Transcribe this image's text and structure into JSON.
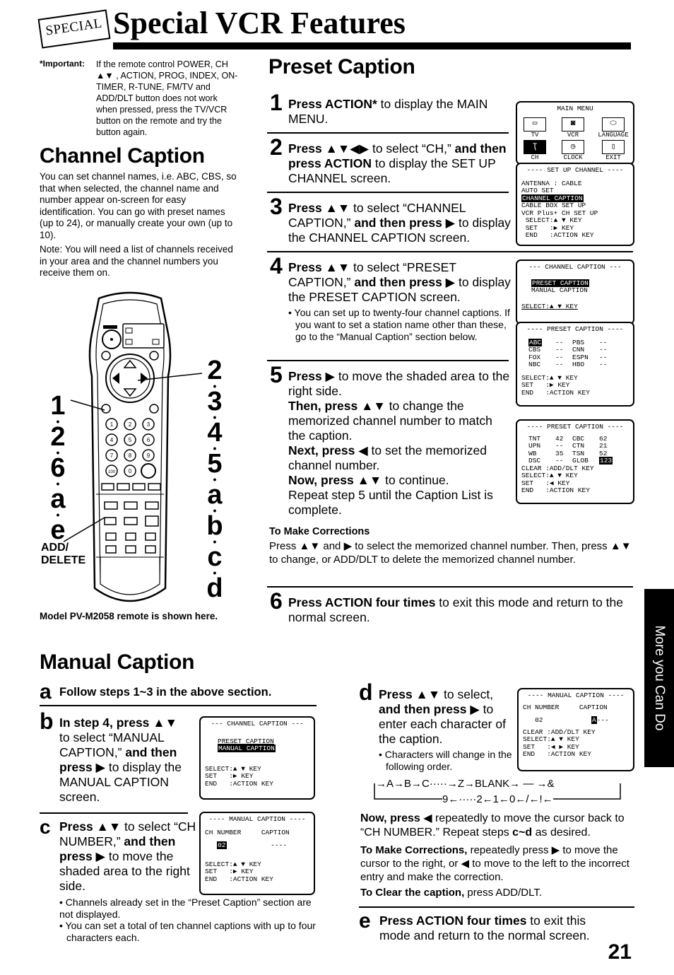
{
  "header": {
    "badge": "SPECIAL",
    "title": "Special VCR Features"
  },
  "important": {
    "label": "*Important:",
    "text": "If the remote control POWER, CH ▲▼ , ACTION, PROG, INDEX, ON-TIMER, R-TUNE, FM/TV and ADD/DLT button does not work when pressed, press the TV/VCR button on the remote and try the button again."
  },
  "channel_caption": {
    "heading": "Channel Caption",
    "intro": "You can set channel names, i.e. ABC, CBS, so that when selected, the channel name and number appear on-screen for easy identification. You can go with preset names (up to 24), or manually create your own (up to 10).",
    "note": "Note: You will need a list of channels received in your area and the channel numbers you receive them on."
  },
  "remote": {
    "left_callouts": [
      "1",
      "2",
      "6",
      "a",
      "e"
    ],
    "right_callouts": [
      "2",
      "3",
      "4",
      "5",
      "a",
      "b",
      "c",
      "d"
    ],
    "add_delete_label_1": "ADD/",
    "add_delete_label_2": "DELETE",
    "caption": "Model PV-M2058 remote is shown here.",
    "number_keys": [
      "1",
      "2",
      "3",
      "4",
      "5",
      "6",
      "7",
      "8",
      "9",
      "100",
      "0"
    ]
  },
  "preset_caption": {
    "heading": "Preset Caption",
    "steps": [
      {
        "num": "1",
        "bold": "Press ACTION*",
        "text": " to display the MAIN MENU."
      },
      {
        "num": "2",
        "bold": "Press ▲▼◀▶",
        "text": " to select “CH,” ",
        "bold2": "and then press ACTION",
        "text2": " to display the SET UP CHANNEL screen."
      },
      {
        "num": "3",
        "bold": "Press ▲▼",
        "text": " to select “CHANNEL CAPTION,” ",
        "bold2": "and then press ▶",
        "text2": " to display the CHANNEL CAPTION screen."
      },
      {
        "num": "4",
        "bold": "Press ▲▼",
        "text": " to select “PRESET CAPTION,” ",
        "bold2": "and then press ▶",
        "text2": " to display the PRESET CAPTION screen.",
        "bullet": "• You can set up to twenty-four channel captions. If you want to set a station name other than these, go to the “Manual Caption” section below."
      },
      {
        "num": "5",
        "bold": "Press ▶",
        "text": " to move the shaded area to the right side.",
        "then_bold": "Then, press ▲▼",
        "then_text": " to change the memorized channel number to match the caption.",
        "next_bold": "Next, press ◀",
        "next_text": " to set the memorized channel number.",
        "now_bold": "Now, press ▲▼",
        "now_text": " to continue.",
        "repeat": "Repeat step 5 until the Caption List is complete."
      },
      {
        "num": "6",
        "bold": "Press ACTION four times",
        "text": " to exit this mode and return to the normal screen."
      }
    ],
    "corrections": {
      "heading": "To Make Corrections",
      "text": "Press ▲▼ and ▶ to select the memorized channel number. Then, press ▲▼ to change, or ADD/DLT to delete the memorized channel number."
    }
  },
  "screens": {
    "main_menu": {
      "title": "MAIN MENU",
      "items": [
        {
          "label": "TV",
          "icon": "tv-icon",
          "glyph": "▭"
        },
        {
          "label": "VCR",
          "icon": "cassette-icon",
          "glyph": "◙"
        },
        {
          "label": "LANGUAGE",
          "icon": "lips-icon",
          "glyph": "⬭"
        },
        {
          "label": "CH",
          "icon": "antenna-icon",
          "glyph": "Ҭ",
          "selected": true
        },
        {
          "label": "CLOCK",
          "icon": "clock-icon",
          "glyph": "◷"
        },
        {
          "label": "EXIT",
          "icon": "door-icon",
          "glyph": "▯"
        }
      ]
    },
    "setup_channel": {
      "title": "---- SET UP CHANNEL ----",
      "lines": [
        "ANTENNA : CABLE",
        "AUTO SET"
      ],
      "highlight": "CHANNEL CAPTION",
      "lines2": [
        "CABLE BOX SET UP",
        "VCR Plus+ CH SET UP"
      ],
      "keys": [
        " SELECT:▲ ▼ KEY",
        " SET   :▶ KEY",
        " END   :ACTION KEY"
      ]
    },
    "channel_caption_preset": {
      "title": "--- CHANNEL CAPTION ---",
      "highlight": "PRESET CAPTION",
      "other": "MANUAL CAPTION",
      "keys": [
        "SELECT:▲ ▼ KEY"
      ]
    },
    "preset_caption_1": {
      "title": "---- PRESET CAPTION ----",
      "rows": [
        [
          "ABC",
          "--",
          "PBS",
          "--"
        ],
        [
          "CBS",
          "--",
          "CNN",
          "--"
        ],
        [
          "FOX",
          "--",
          "ESPN",
          "--"
        ],
        [
          "NBC",
          "--",
          "HBO",
          "--"
        ]
      ],
      "highlight_cell": "ABC",
      "keys": [
        "SELECT:▲ ▼ KEY",
        "SET   :▶ KEY",
        "END   :ACTION KEY"
      ]
    },
    "preset_caption_2": {
      "title": "---- PRESET CAPTION ----",
      "rows": [
        [
          "TNT",
          "42",
          "CBC",
          "62"
        ],
        [
          "UPN",
          "--",
          "CTN",
          "21"
        ],
        [
          "WB",
          "35",
          "TSN",
          "52"
        ],
        [
          "DSC",
          "--",
          "GLOB",
          "123"
        ]
      ],
      "highlight_cell": "123",
      "keys": [
        "CLEAR :ADD/DLT KEY",
        "SELECT:▲ ▼ KEY",
        "SET   :◀ KEY",
        "END   :ACTION KEY"
      ]
    },
    "channel_caption_manual": {
      "title": "--- CHANNEL CAPTION ---",
      "other": "PRESET CAPTION",
      "highlight": "MANUAL CAPTION",
      "keys": [
        "SELECT:▲ ▼ KEY",
        "SET   :▶ KEY",
        "END   :ACTION KEY"
      ]
    },
    "manual_caption_1": {
      "title": "---- MANUAL CAPTION ----",
      "col1": "CH NUMBER",
      "col2": "CAPTION",
      "ch_value": "02",
      "caption_value": "----",
      "keys": [
        "SELECT:▲ ▼ KEY",
        "SET   :▶ KEY",
        "END   :ACTION KEY"
      ]
    },
    "manual_caption_2": {
      "title": "---- MANUAL CAPTION ----",
      "col1": "CH NUMBER",
      "col2": "CAPTION",
      "ch_value": "02",
      "caption_cursor": "A",
      "caption_rest": "---",
      "keys": [
        "CLEAR :ADD/DLT KEY",
        "SELECT:▲ ▼ KEY",
        "SET   :◀ ▶ KEY",
        "END   :ACTION KEY"
      ]
    }
  },
  "manual_caption": {
    "heading": "Manual Caption",
    "step_a": {
      "letter": "a",
      "text": "Follow steps 1~3 in the above section."
    },
    "step_b": {
      "letter": "b",
      "bold": "In step 4, press ▲▼",
      "text": " to select “MANUAL CAPTION,” ",
      "bold2": "and then press ▶",
      "text2": " to display the MANUAL CAPTION screen."
    },
    "step_c": {
      "letter": "c",
      "bold": "Press ▲▼",
      "text": " to select “CH NUMBER,” ",
      "bold2": "and then press ▶",
      "text2": " to move the shaded area to the right side.",
      "bullets": [
        "• Channels already set in the “Preset Caption” section are not displayed.",
        "• You can set a total of ten channel captions with up to four characters each."
      ]
    },
    "step_d": {
      "letter": "d",
      "bold": "Press ▲▼",
      "text": " to select, ",
      "bold2": "and then press ▶",
      "text2": " to enter each character of the caption.",
      "bullet": "• Characters will change in the following order."
    },
    "char_order_top": "→A→B→C·····→Z→BLANK→ — →&",
    "char_order_bottom": "9←·····2←1←0←/←!←",
    "now_press_bold": "Now, press ◀",
    "now_press_text": " repeatedly to move the cursor back to “CH NUMBER.” Repeat steps ",
    "now_press_steps": "c~d",
    "now_press_end": " as desired.",
    "corrections_bold": "To Make Corrections,",
    "corrections_text": " repeatedly press ▶ to move the cursor to the right, or ◀ to move to the left to the incorrect entry and make the correction.",
    "clear_bold": "To Clear the caption,",
    "clear_text": " press ADD/DLT.",
    "step_e": {
      "letter": "e",
      "bold": "Press ACTION four times",
      "text": " to exit this mode and return to the normal screen."
    }
  },
  "side_tab": "More you Can Do",
  "page_number": "21"
}
